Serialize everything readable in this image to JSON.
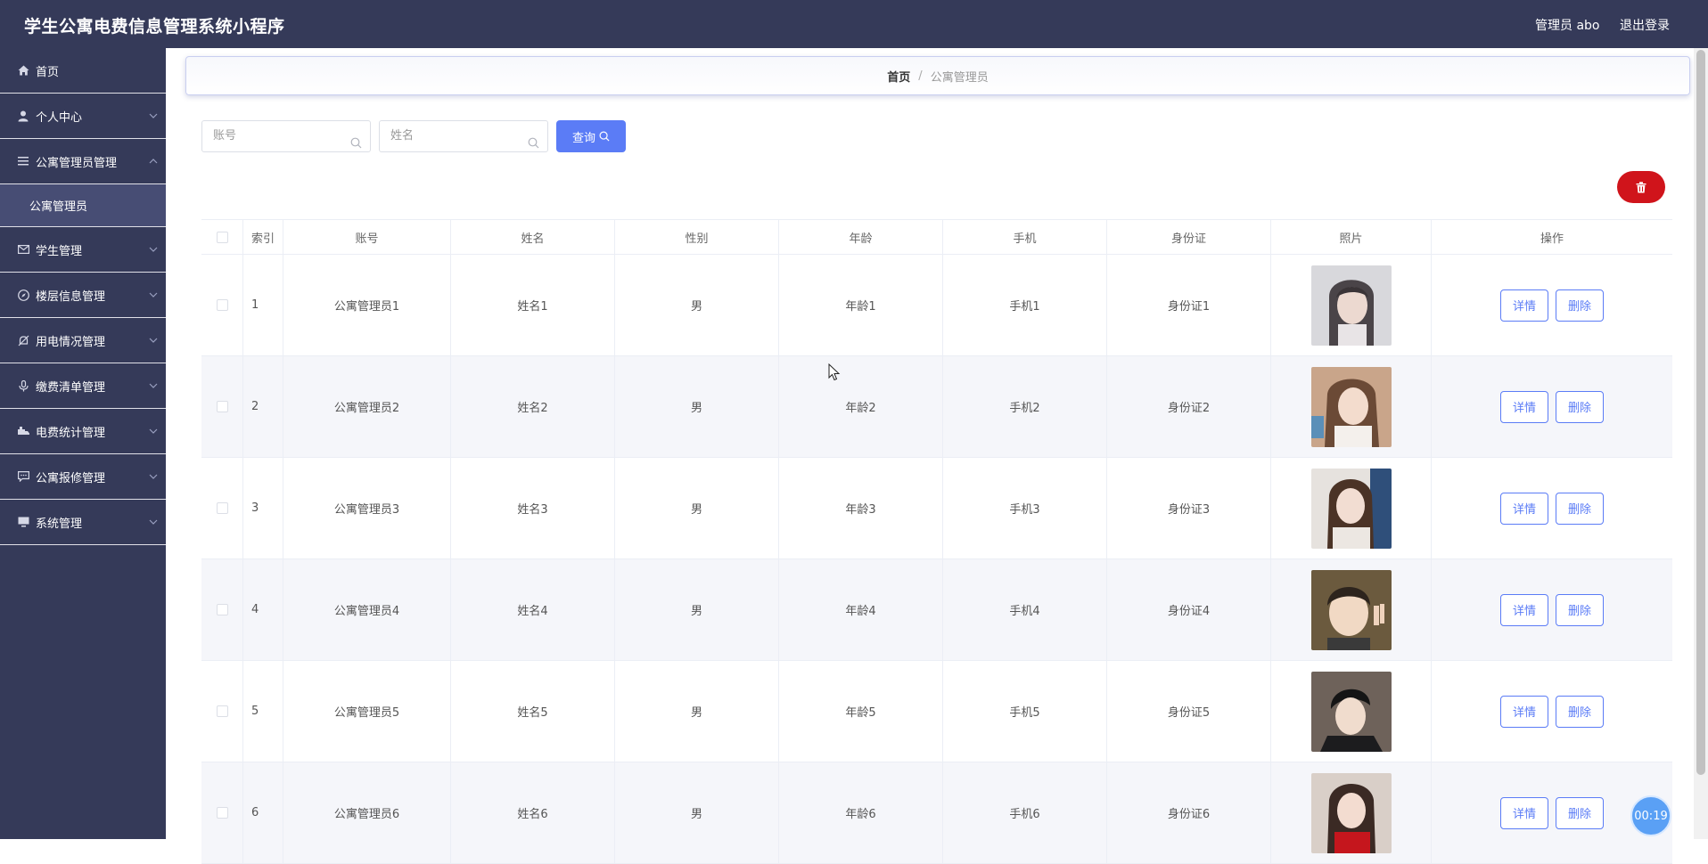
{
  "header": {
    "title": "学生公寓电费信息管理系统小程序",
    "user": "管理员 abo",
    "logout": "退出登录"
  },
  "sidebar": {
    "items": [
      {
        "label": "首页",
        "icon": "home-icon",
        "expandable": false
      },
      {
        "label": "个人中心",
        "icon": "user-icon",
        "expandable": true
      },
      {
        "label": "公寓管理员管理",
        "icon": "list-icon",
        "expandable": true,
        "expanded": true,
        "children": [
          "公寓管理员"
        ]
      },
      {
        "label": "学生管理",
        "icon": "mail-icon",
        "expandable": true
      },
      {
        "label": "楼层信息管理",
        "icon": "compass-icon",
        "expandable": true
      },
      {
        "label": "用电情况管理",
        "icon": "bell-off-icon",
        "expandable": true
      },
      {
        "label": "缴费清单管理",
        "icon": "microphone-icon",
        "expandable": true
      },
      {
        "label": "电费统计管理",
        "icon": "truck-icon",
        "expandable": true
      },
      {
        "label": "公寓报修管理",
        "icon": "chat-icon",
        "expandable": true
      },
      {
        "label": "系统管理",
        "icon": "monitor-icon",
        "expandable": true
      }
    ]
  },
  "breadcrumb": {
    "home": "首页",
    "separator": "/",
    "current": "公寓管理员"
  },
  "search": {
    "account_placeholder": "账号",
    "name_placeholder": "姓名",
    "button_label": "查询"
  },
  "table": {
    "columns": [
      "索引",
      "账号",
      "姓名",
      "性别",
      "年龄",
      "手机",
      "身份证",
      "照片",
      "操作"
    ],
    "rows": [
      {
        "index": "1",
        "account": "公寓管理员1",
        "name": "姓名1",
        "sex": "男",
        "age": "年龄1",
        "phone": "手机1",
        "id_card": "身份证1"
      },
      {
        "index": "2",
        "account": "公寓管理员2",
        "name": "姓名2",
        "sex": "男",
        "age": "年龄2",
        "phone": "手机2",
        "id_card": "身份证2"
      },
      {
        "index": "3",
        "account": "公寓管理员3",
        "name": "姓名3",
        "sex": "男",
        "age": "年龄3",
        "phone": "手机3",
        "id_card": "身份证3"
      },
      {
        "index": "4",
        "account": "公寓管理员4",
        "name": "姓名4",
        "sex": "男",
        "age": "年龄4",
        "phone": "手机4",
        "id_card": "身份证4"
      },
      {
        "index": "5",
        "account": "公寓管理员5",
        "name": "姓名5",
        "sex": "男",
        "age": "年龄5",
        "phone": "手机5",
        "id_card": "身份证5"
      },
      {
        "index": "6",
        "account": "公寓管理员6",
        "name": "姓名6",
        "sex": "男",
        "age": "年龄6",
        "phone": "手机6",
        "id_card": "身份证6"
      }
    ],
    "detail_label": "详情",
    "delete_label": "删除"
  },
  "timer": "00:19",
  "colors": {
    "sidebar_bg": "#353a59",
    "submenu_active_bg": "#474d74",
    "accent": "#5b7cf6",
    "danger": "#d0141b"
  }
}
